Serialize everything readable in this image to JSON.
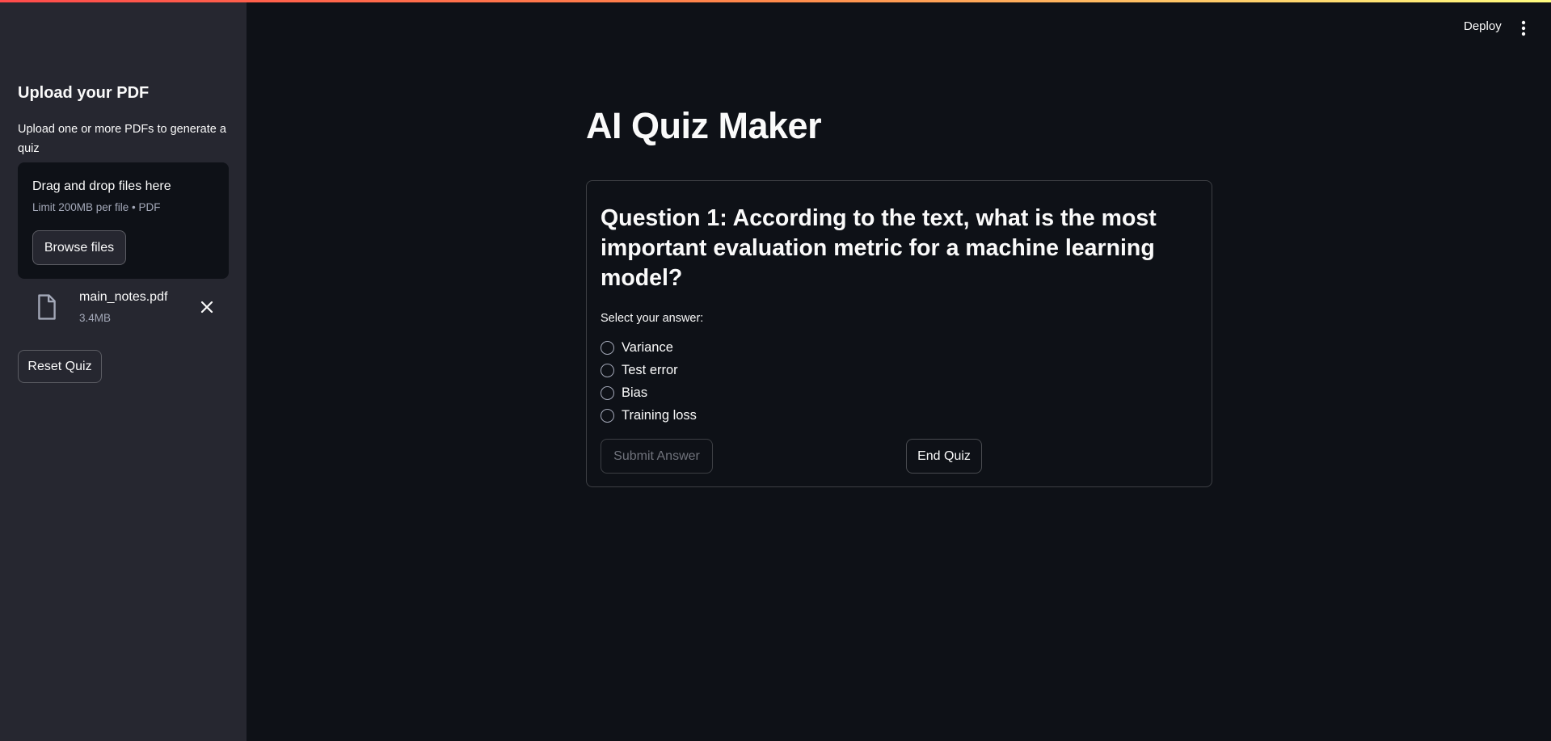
{
  "header": {
    "deploy_label": "Deploy",
    "menu_icon": "kebab-menu-icon"
  },
  "sidebar": {
    "title": "Upload your PDF",
    "description": "Upload one or more PDFs to generate a quiz",
    "dropzone": {
      "title": "Drag and drop files here",
      "limit": "Limit 200MB per file • PDF",
      "browse_label": "Browse files"
    },
    "file": {
      "icon": "file-icon",
      "name": "main_notes.pdf",
      "size": "3.4MB",
      "remove_icon": "close-icon"
    },
    "reset_label": "Reset Quiz"
  },
  "main": {
    "title": "AI Quiz Maker",
    "question": "Question 1: According to the text, what is the most important evaluation metric for a machine learning model?",
    "select_label": "Select your answer:",
    "options": [
      "Variance",
      "Test error",
      "Bias",
      "Training loss"
    ],
    "submit_label": "Submit Answer",
    "end_label": "End Quiz"
  },
  "colors": {
    "background": "#0e1117",
    "sidebar": "#262730",
    "text": "#fafafa",
    "muted": "#a3a8b8",
    "accent_red": "#ff4b4b"
  }
}
